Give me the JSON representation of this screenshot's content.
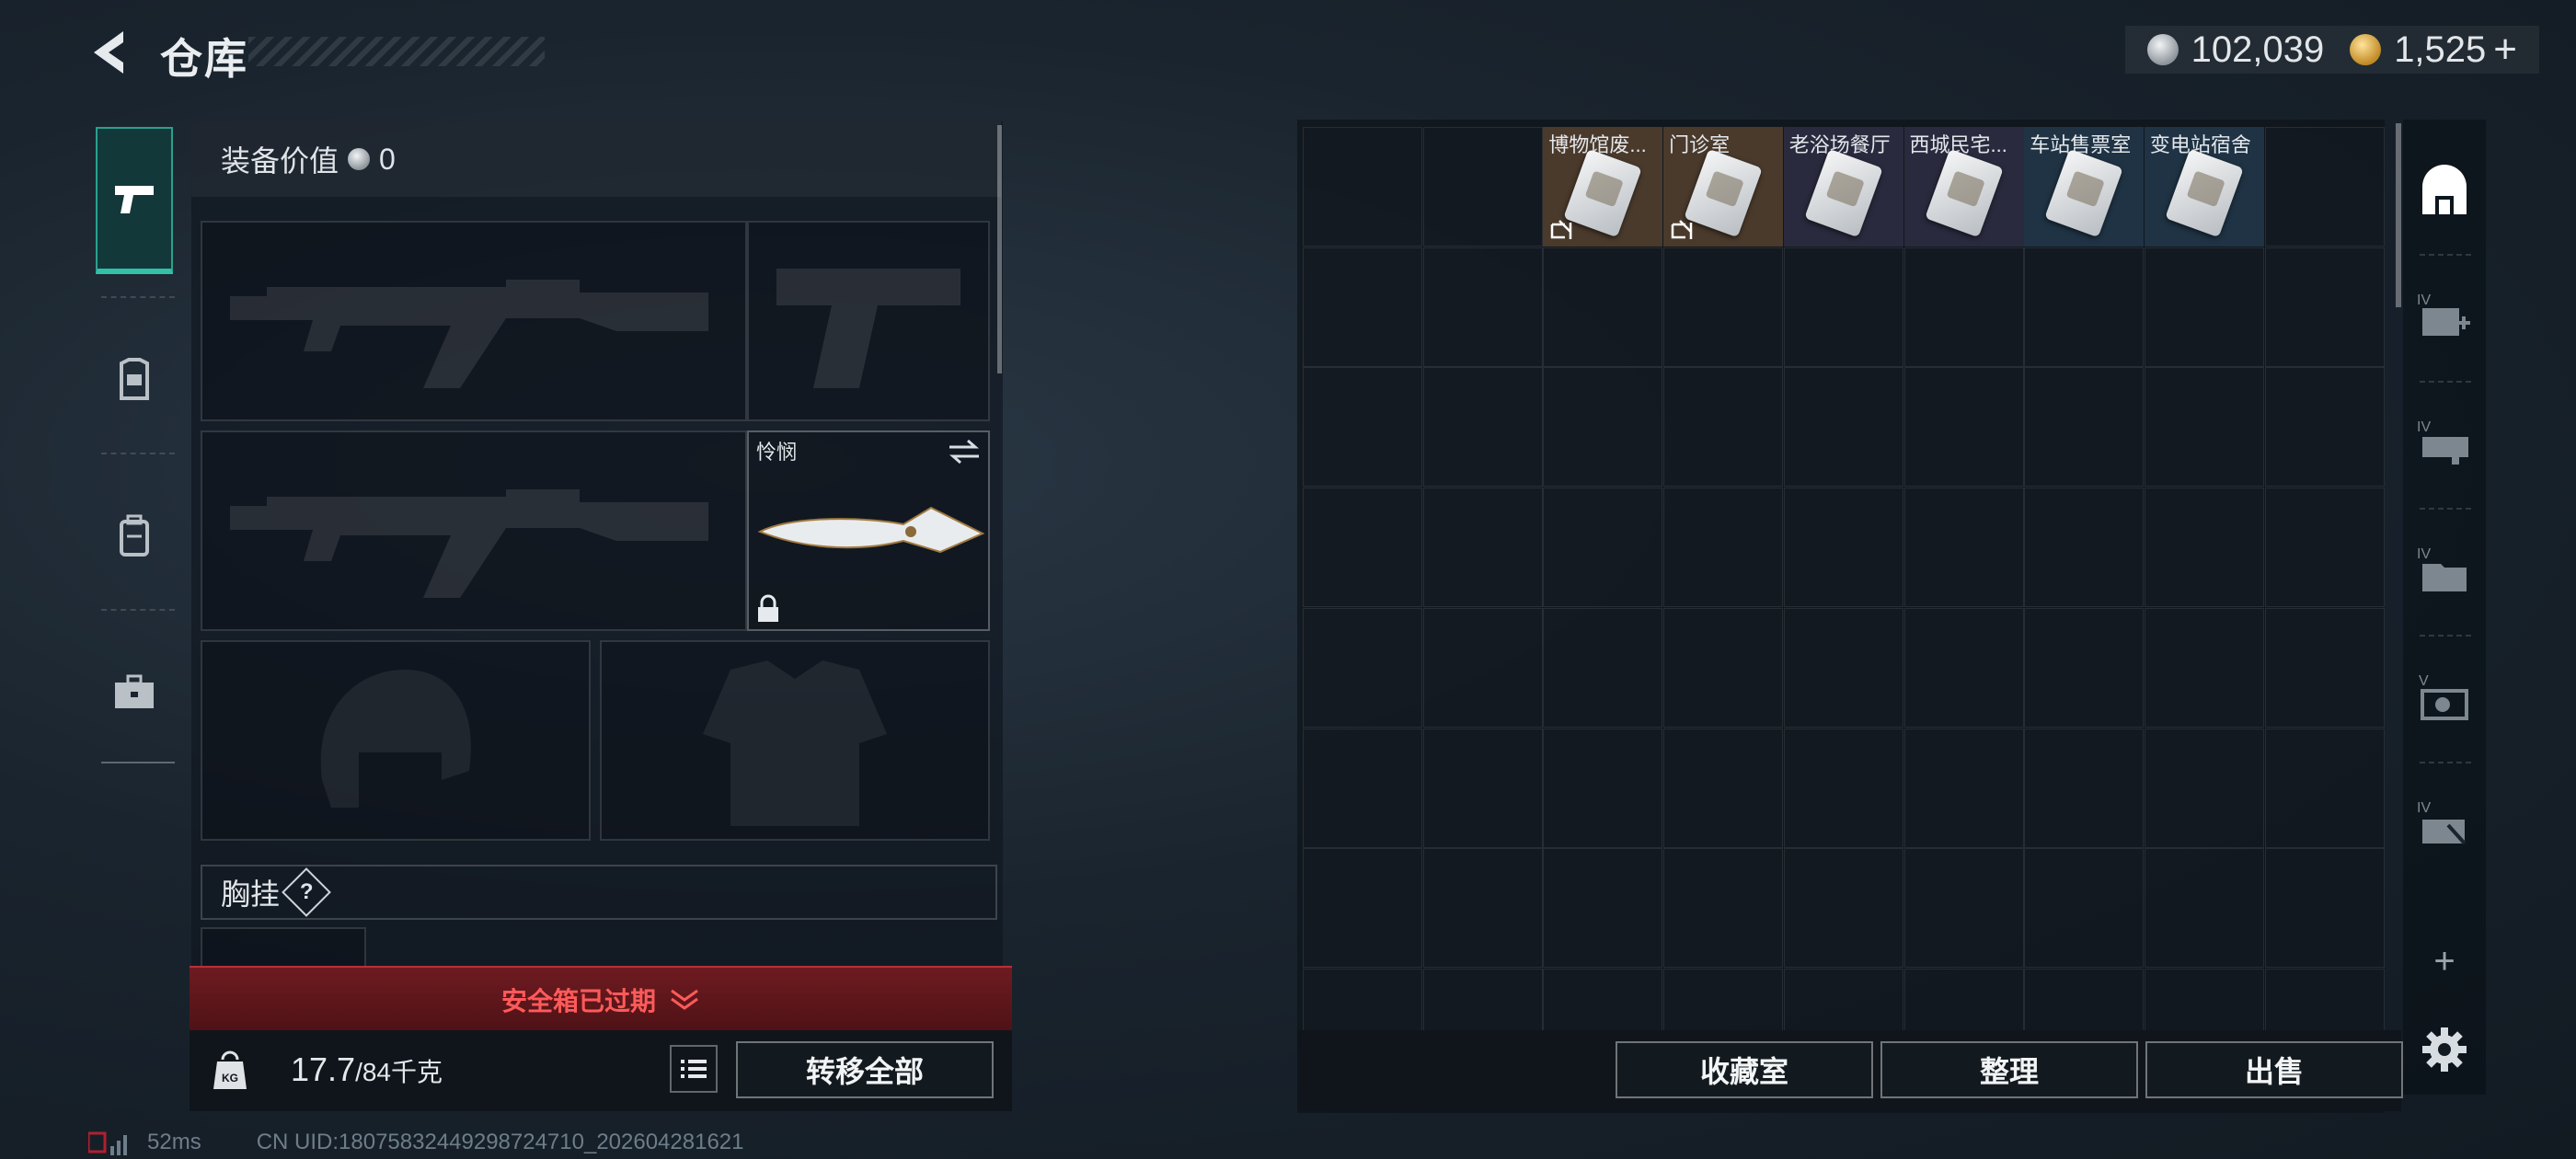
{
  "header": {
    "title": "仓库",
    "silver": "102,039",
    "gold": "1,525",
    "gold_plus": "+"
  },
  "tabs": [
    {
      "name": "weapons",
      "icon": "pistol-icon",
      "active": true
    },
    {
      "name": "gear",
      "icon": "vest-icon"
    },
    {
      "name": "backpack",
      "icon": "backpack-icon"
    },
    {
      "name": "toolbox",
      "icon": "briefcase-icon"
    }
  ],
  "equip": {
    "value_label": "装备价值",
    "value": "0",
    "melee_name": "怜悯",
    "chest_rig_label": "胸挂",
    "help_glyph": "?"
  },
  "safe_banner": "安全箱已过期",
  "weight": {
    "current": "17.7",
    "max": "/84千克",
    "icon_label": "KG"
  },
  "buttons": {
    "transfer_all": "转移全部",
    "collection": "收藏室",
    "organize": "整理",
    "sell": "出售"
  },
  "storage_items": [
    {
      "name": "博物馆废...",
      "rarity": "orange",
      "bound": true
    },
    {
      "name": "门诊室",
      "rarity": "orange",
      "bound": true
    },
    {
      "name": "老浴场餐厅",
      "rarity": "purple",
      "bound": false
    },
    {
      "name": "西城民宅...",
      "rarity": "purple",
      "bound": false
    },
    {
      "name": "车站售票室",
      "rarity": "blue",
      "bound": false
    },
    {
      "name": "变电站宿舍",
      "rarity": "blue",
      "bound": false
    }
  ],
  "side_icons": [
    "home-storage-icon",
    "add-case-icon",
    "case-gun-icon",
    "case-folder-icon",
    "case-camera-icon",
    "case-tools-icon",
    "plus-icon",
    "settings-gear-icon"
  ],
  "side_levels": [
    "IV",
    "IV",
    "IV",
    "V",
    "IV"
  ],
  "side_plus": "+",
  "status": {
    "ping": "52ms",
    "uid": "CN UID:18075832449298724710_202604281621"
  },
  "colors": {
    "orange": "#4a3a2c",
    "purple": "#2a2a3e",
    "blue": "#1f3344",
    "accent": "#32c0a8",
    "danger": "#ff5a5a"
  }
}
